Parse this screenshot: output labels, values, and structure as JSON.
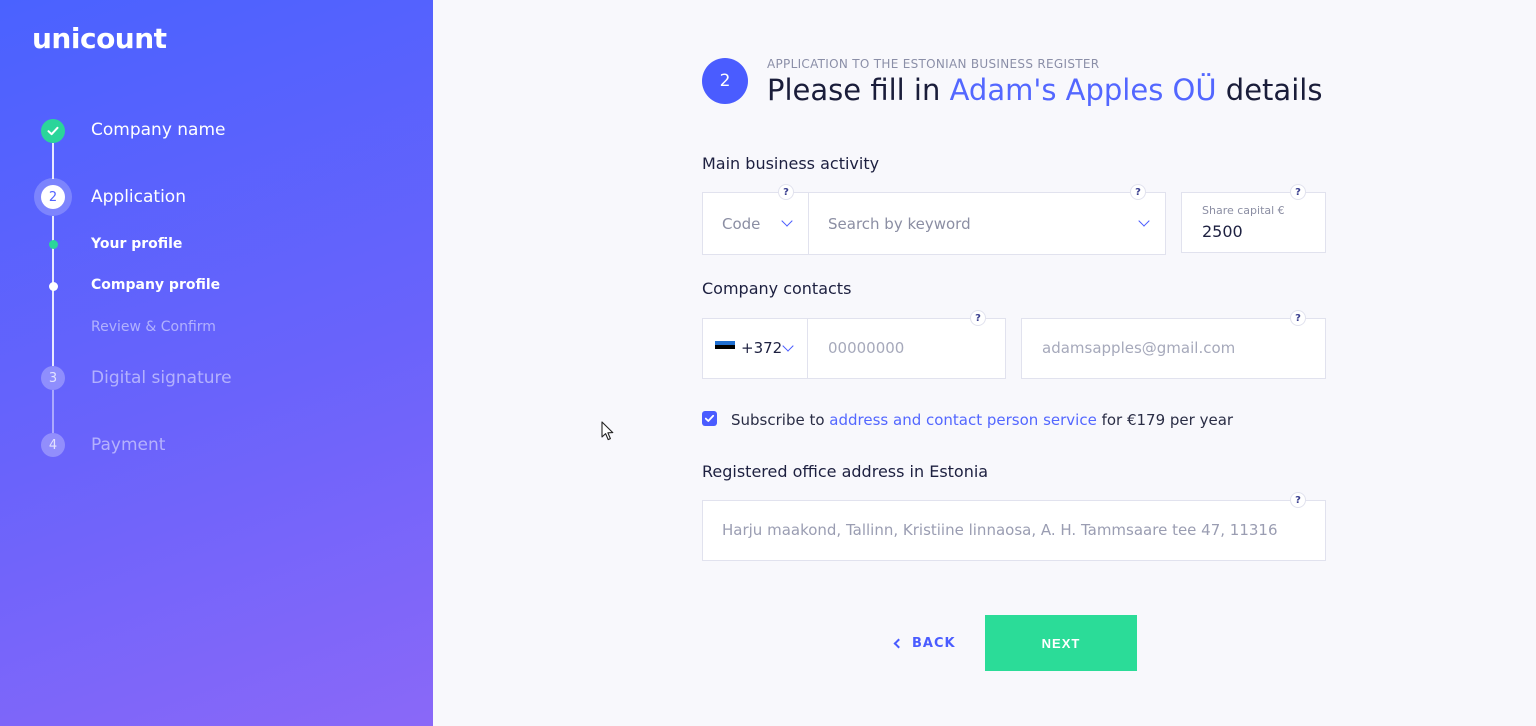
{
  "sidebar": {
    "logo": "unicount",
    "steps": [
      {
        "label": "Company name",
        "state": "done"
      },
      {
        "number": "2",
        "label": "Application",
        "state": "active"
      },
      {
        "number": "3",
        "label": "Digital signature",
        "state": "upcoming"
      },
      {
        "number": "4",
        "label": "Payment",
        "state": "upcoming"
      }
    ],
    "substeps": [
      {
        "label": "Your profile",
        "state": "done"
      },
      {
        "label": "Company profile",
        "state": "active"
      },
      {
        "label": "Review & Confirm",
        "state": "upcoming"
      }
    ]
  },
  "header": {
    "step_number": "2",
    "pre_title": "APPLICATION TO THE ESTONIAN BUSINESS REGISTER",
    "title_prefix": "Please fill in ",
    "company_name": "Adam's Apples OÜ",
    "title_suffix": " details"
  },
  "business_activity": {
    "label": "Main business activity",
    "code_placeholder": "Code",
    "search_placeholder": "Search by keyword",
    "share_capital_label": "Share capital €",
    "share_capital_value": "2500",
    "help": "?"
  },
  "contacts": {
    "label": "Company contacts",
    "country_code": "+372",
    "phone_placeholder": "00000000",
    "email_placeholder": "adamsapples@gmail.com",
    "help": "?"
  },
  "subscribe": {
    "checked": true,
    "prefix": "Subscribe to ",
    "link": "address and contact person service",
    "suffix": " for €179 per year"
  },
  "address": {
    "label": "Registered office address in Estonia",
    "placeholder": "Harju maakond, Tallinn, Kristiine linnaosa, A. H. Tammsaare tee 47, 11316",
    "help": "?"
  },
  "actions": {
    "back_label": "BACK",
    "next_label": "NEXT"
  },
  "colors": {
    "accent": "#4a5cff",
    "success": "#2bdc98",
    "sidebar_from": "#4a62ff",
    "sidebar_to": "#8a68f8"
  }
}
